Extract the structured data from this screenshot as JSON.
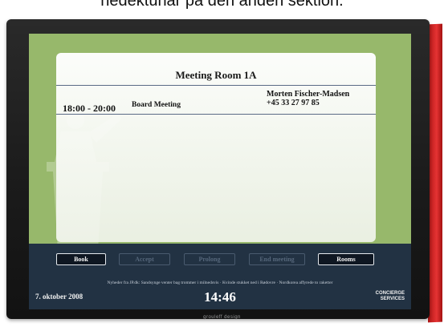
{
  "caption": "nedektunar på den anden sektion.",
  "device": {
    "brand": "grouleff design"
  },
  "room": {
    "title": "Meeting Room 1A"
  },
  "meeting": {
    "time": "18:00 - 20:00",
    "title": "Board Meeting",
    "organizer": "Morten Fischer-Madsen",
    "phone": "+45 33 27 97 85"
  },
  "buttons": [
    {
      "label": "Book",
      "state": "active"
    },
    {
      "label": "Accept",
      "state": "disabled"
    },
    {
      "label": "Prolong",
      "state": "disabled"
    },
    {
      "label": "End meeting",
      "state": "disabled"
    },
    {
      "label": "Rooms",
      "state": "active"
    }
  ],
  "ticker": "Nyheder fra JP.dk: Sandsynge venter bag trommer i milnedsvis  ·  Kvinde stukket ned i Rødovre  ·  Nordkorea affyrede to raketter",
  "footer": {
    "date": "7. oktober 2008",
    "clock": "14:46",
    "logo_line1": "CONCIERGE",
    "logo_line2": "SERVICES"
  },
  "colors": {
    "screen_bg": "#97b86b",
    "bar_bg": "#223243",
    "frame_red": "#d62b2b"
  }
}
